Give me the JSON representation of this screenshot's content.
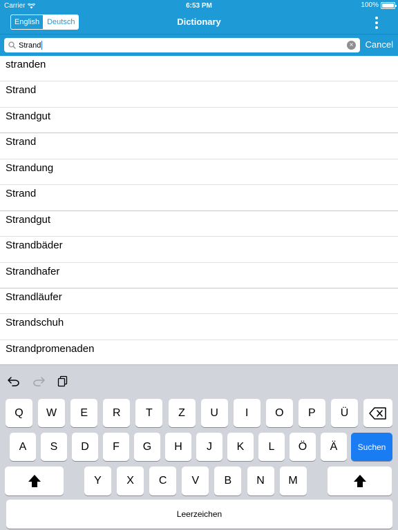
{
  "status_bar": {
    "carrier": "Carrier",
    "time": "6:53 PM",
    "battery": "100%"
  },
  "nav": {
    "lang_options": [
      "English",
      "Deutsch"
    ],
    "selected_lang": "English",
    "title": "Dictionary"
  },
  "search": {
    "value": "Strand",
    "cancel_label": "Cancel"
  },
  "results": [
    "stranden",
    "Strand",
    "Strandgut",
    "Strand",
    "Strandung",
    "Strand",
    "Strandgut",
    "Strandbäder",
    "Strandhafer",
    "Strandläufer",
    "Strandschuh",
    "Strandpromenaden"
  ],
  "keyboard": {
    "row1": [
      "Q",
      "W",
      "E",
      "R",
      "T",
      "Z",
      "U",
      "I",
      "O",
      "P",
      "Ü"
    ],
    "row2": [
      "A",
      "S",
      "D",
      "F",
      "G",
      "H",
      "J",
      "K",
      "L",
      "Ö",
      "Ä"
    ],
    "row3": [
      "Y",
      "X",
      "C",
      "V",
      "B",
      "N",
      "M"
    ],
    "return_label": "Suchen",
    "space_label": "Leerzeichen"
  },
  "colors": {
    "accent": "#1e9ad6",
    "key_blue": "#1a7cf2"
  }
}
